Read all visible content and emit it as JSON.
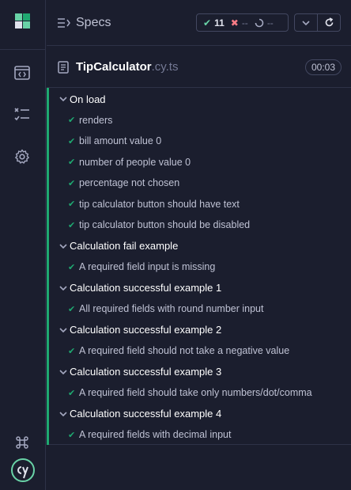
{
  "header": {
    "title": "Specs"
  },
  "stats": {
    "passed": "11",
    "failed": "--",
    "pending": "--"
  },
  "spec": {
    "name": "TipCalculator",
    "extension": ".cy.ts",
    "duration": "00:03"
  },
  "suites": [
    {
      "title": "On load",
      "tests": [
        "renders",
        "bill amount value 0",
        "number of people value 0",
        "percentage not chosen",
        "tip calculator button should have text",
        "tip calculator button should be disabled"
      ]
    },
    {
      "title": "Calculation fail example",
      "tests": [
        "A required field input is missing"
      ]
    },
    {
      "title": "Calculation successful example 1",
      "tests": [
        "All required fields with round number input"
      ]
    },
    {
      "title": "Calculation successful example 2",
      "tests": [
        "A required field should not take a negative value"
      ]
    },
    {
      "title": "Calculation successful example 3",
      "tests": [
        "A required field should take only numbers/dot/comma"
      ]
    },
    {
      "title": "Calculation successful example 4",
      "tests": [
        "A required fields with decimal input"
      ]
    }
  ],
  "colors": {
    "pass": "#1fa971",
    "fail": "#f87c86",
    "accent": "#69d3a7",
    "background": "#1b1e2e"
  }
}
